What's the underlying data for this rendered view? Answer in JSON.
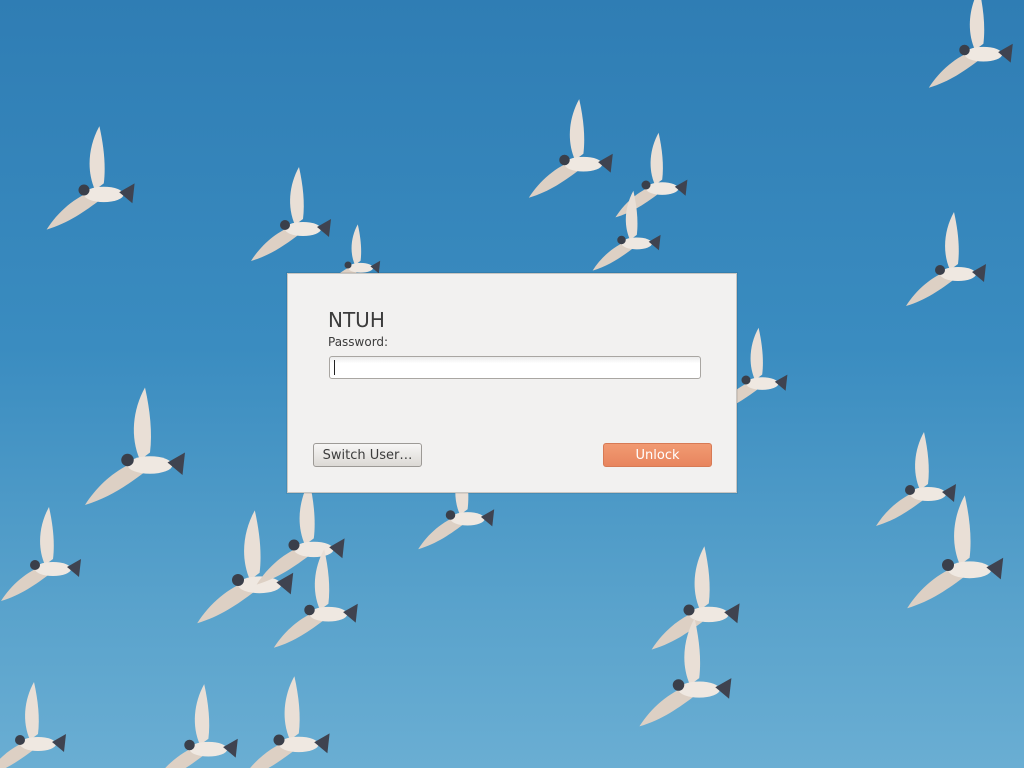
{
  "wallpaper": {
    "description_icon": "doves-wallpaper",
    "sky_color": "#3a8cc0"
  },
  "lock_dialog": {
    "username": "NTUH",
    "password_label": "Password:",
    "password_value": "",
    "switch_user_label": "Switch User…",
    "unlock_label": "Unlock",
    "accent_color": "#e8855e"
  }
}
